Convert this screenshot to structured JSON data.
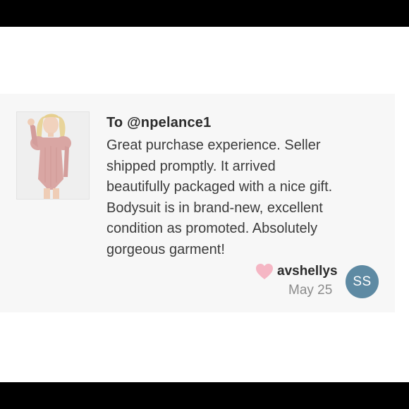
{
  "review_card": {
    "recipient": "To @npelance1",
    "review_lines": [
      "Great purchase experience. Seller",
      "shipped promptly. It arrived",
      "beautifully packaged with a nice gift.",
      "Bodysuit is in brand-new, excellent",
      "condition as promoted. Absolutely",
      "gorgeous garment!"
    ],
    "reviewer": {
      "username": "avshellys",
      "date": "May 25",
      "avatar_initials": "SS",
      "avatar_color": "#5e8aa3"
    },
    "heart_color": "#f5b6c4",
    "thumbnail_icon": "product-photo-pink-bodysuit"
  }
}
